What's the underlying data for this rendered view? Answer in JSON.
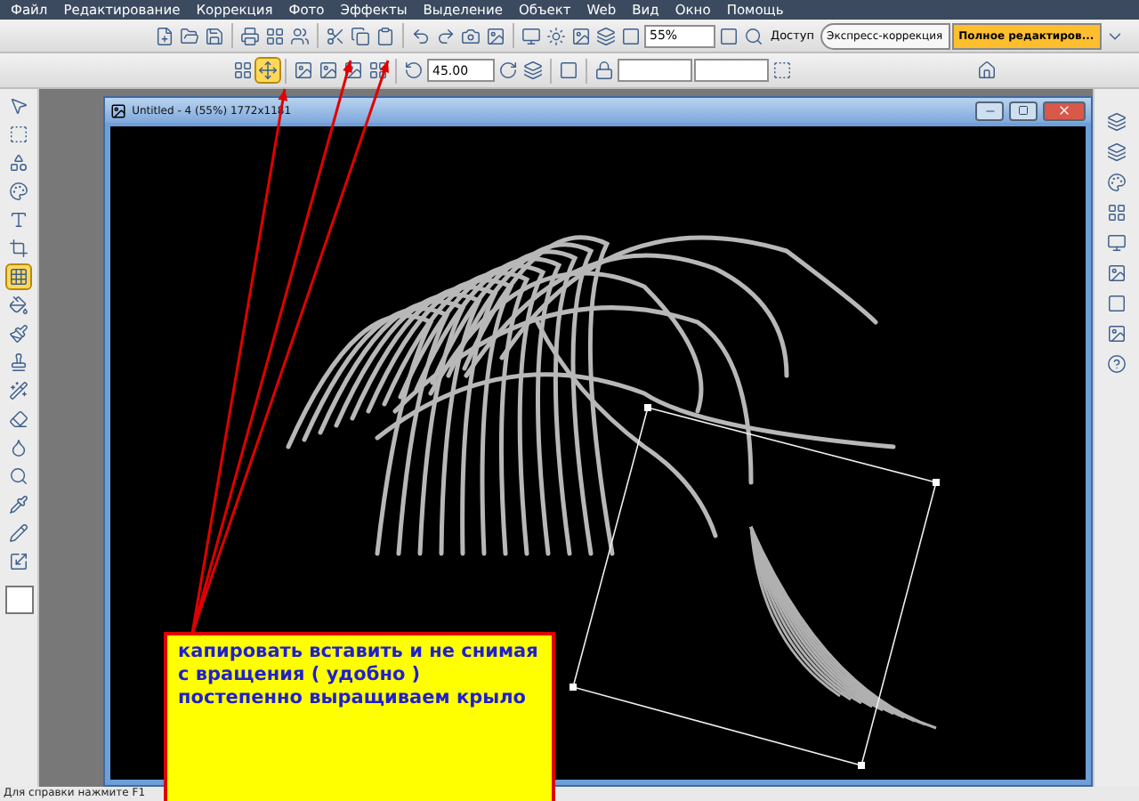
{
  "menu": [
    "Файл",
    "Редактирование",
    "Коррекция",
    "Фото",
    "Эффекты",
    "Выделение",
    "Объект",
    "Web",
    "Вид",
    "Окно",
    "Помощь"
  ],
  "toolbar": {
    "zoom": "55%",
    "share": "Доступ",
    "modes": [
      {
        "label": "Экспресс-коррекция",
        "selected": false
      },
      {
        "label": "Полное редактиров...",
        "selected": true
      }
    ]
  },
  "options_bar": {
    "angle": "45.00",
    "tools": [
      {
        "kind": "layout",
        "selected": false
      },
      {
        "kind": "transform",
        "selected": true
      }
    ]
  },
  "tools": [
    {
      "kind": "pointer",
      "selected": false
    },
    {
      "kind": "marquee",
      "selected": false
    },
    {
      "kind": "shapes",
      "selected": false
    },
    {
      "kind": "fill",
      "selected": false
    },
    {
      "kind": "text",
      "selected": false
    },
    {
      "kind": "crop",
      "selected": false
    },
    {
      "kind": "grid",
      "selected": true
    },
    {
      "kind": "bucket",
      "selected": false
    },
    {
      "kind": "brush",
      "selected": false
    },
    {
      "kind": "stamp",
      "selected": false
    },
    {
      "kind": "wand",
      "selected": false
    },
    {
      "kind": "eraser",
      "selected": false
    },
    {
      "kind": "smudge",
      "selected": false
    },
    {
      "kind": "zoom",
      "selected": false
    },
    {
      "kind": "dropper",
      "selected": false
    },
    {
      "kind": "pencil",
      "selected": false
    },
    {
      "kind": "resize",
      "selected": false
    }
  ],
  "document": {
    "title": "Untitled - 4 (55%) 1772x1181"
  },
  "note": {
    "text": "капировать вставить и не снимая с вращения ( удобно ) постепенно выращиваем крыло"
  },
  "status_bar": {
    "text": "Для справки нажмите F1"
  }
}
